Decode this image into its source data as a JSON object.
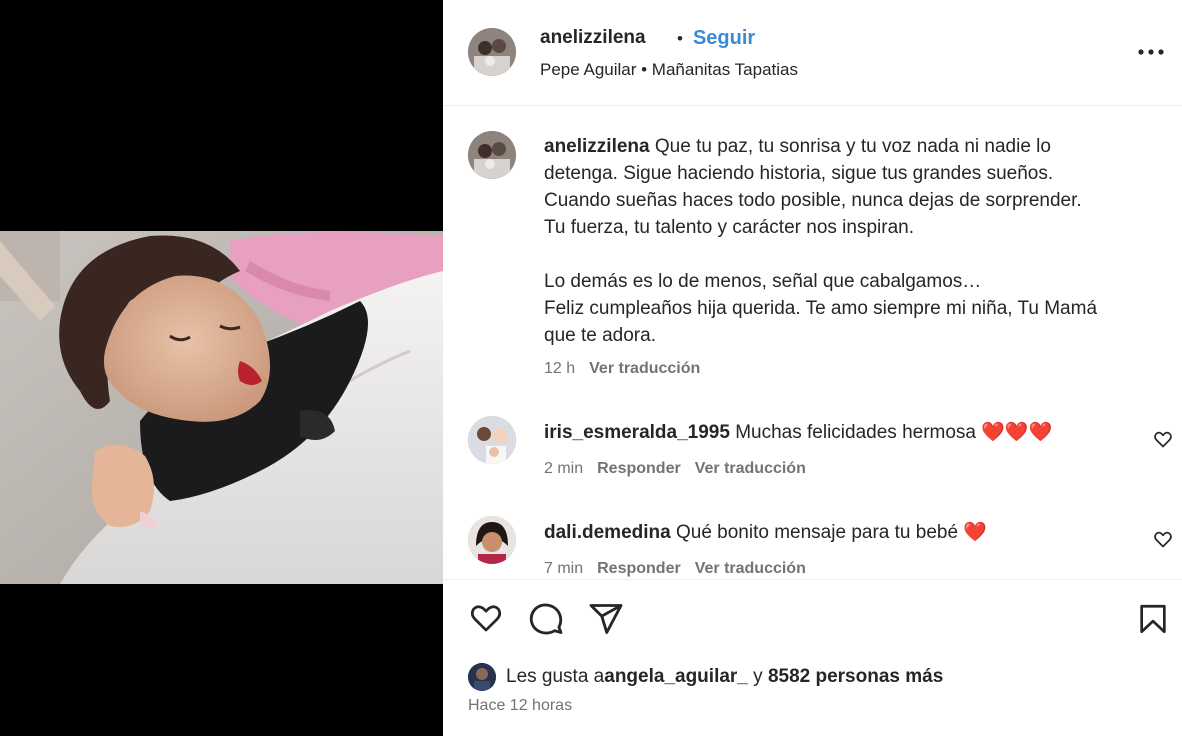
{
  "header": {
    "username": "anelizzilena",
    "separator": "•",
    "follow_label": "Seguir",
    "music": "Pepe Aguilar • Mañanitas Tapatias"
  },
  "caption": {
    "username": "anelizzilena",
    "text": " Que tu paz, tu sonrisa y tu voz nada ni nadie lo\ndetenga. Sigue haciendo historia, sigue tus grandes sueños.\nCuando sueñas haces todo posible, nunca dejas de sorprender.\nTu fuerza, tu talento y carácter nos inspiran.\n\nLo demás es lo de menos, señal que cabalgamos…\nFeliz cumpleaños hija querida. Te amo siempre mi niña, Tu Mamá\nque te adora.",
    "time": "12 h",
    "translate": "Ver traducción"
  },
  "comments": [
    {
      "username": "iris_esmeralda_1995",
      "text": " Muchas felicidades hermosa ❤️❤️❤️",
      "time": "2 min",
      "reply": "Responder",
      "translate": "Ver traducción"
    },
    {
      "username": "dali.demedina",
      "text": " Qué bonito mensaje para tu bebé ❤️",
      "time": "7 min",
      "reply": "Responder",
      "translate": "Ver traducción"
    }
  ],
  "likes": {
    "prefix": "Les gusta a ",
    "user": "angela_aguilar_",
    "middle": " y ",
    "count": "8582 personas más"
  },
  "posted_ago": "Hace 12 horas",
  "icons": [
    "more-icon",
    "heart-icon",
    "comment-icon",
    "share-icon",
    "bookmark-icon",
    "like-comment-icon"
  ],
  "colors": {
    "follow": "#3a8bd6",
    "muted": "#737373",
    "text": "#262626",
    "heart": "#e0202a"
  }
}
